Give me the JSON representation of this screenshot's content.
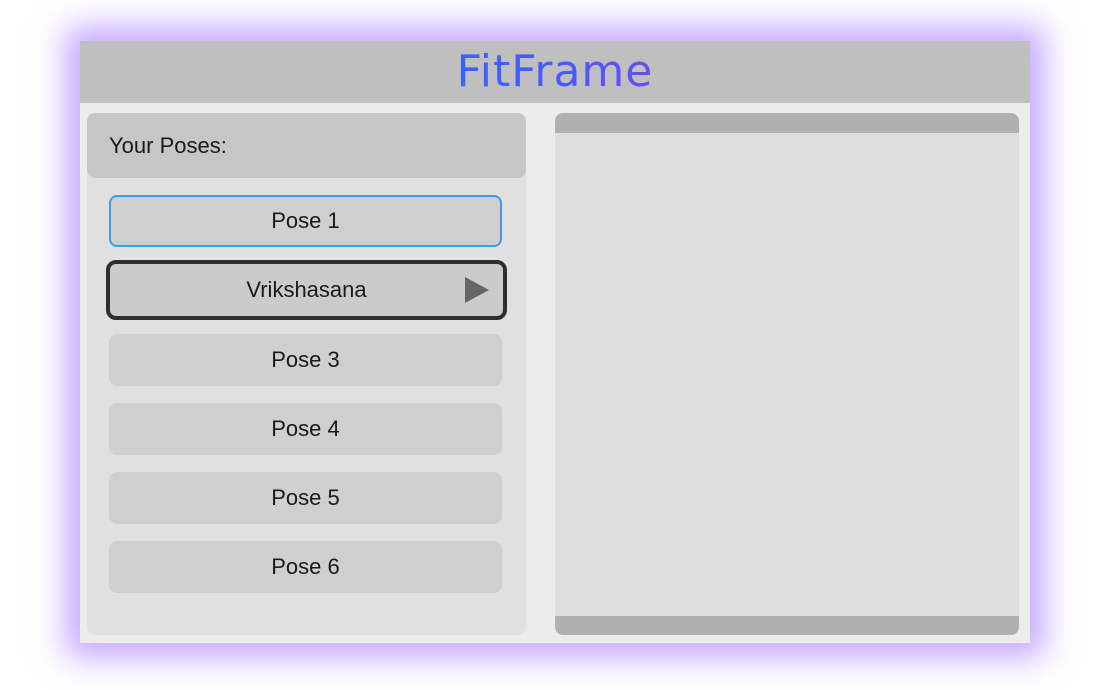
{
  "app": {
    "title": "FitFrame",
    "title_gradient": [
      "#3a63ff",
      "#6a4cf5"
    ],
    "glow_color": "#965fff"
  },
  "poses_panel": {
    "header": "Your Poses:",
    "items": [
      {
        "label": "Pose 1",
        "state": "focused"
      },
      {
        "label": "Vrikshasana",
        "state": "selected",
        "icon": "play-icon"
      },
      {
        "label": "Pose 3",
        "state": "normal"
      },
      {
        "label": "Pose 4",
        "state": "normal"
      },
      {
        "label": "Pose 5",
        "state": "normal"
      },
      {
        "label": "Pose 6",
        "state": "normal"
      }
    ]
  },
  "colors": {
    "focus_border": "#3aa0e6",
    "selected_border": "#2e2e2e",
    "play_icon": "#666666"
  }
}
